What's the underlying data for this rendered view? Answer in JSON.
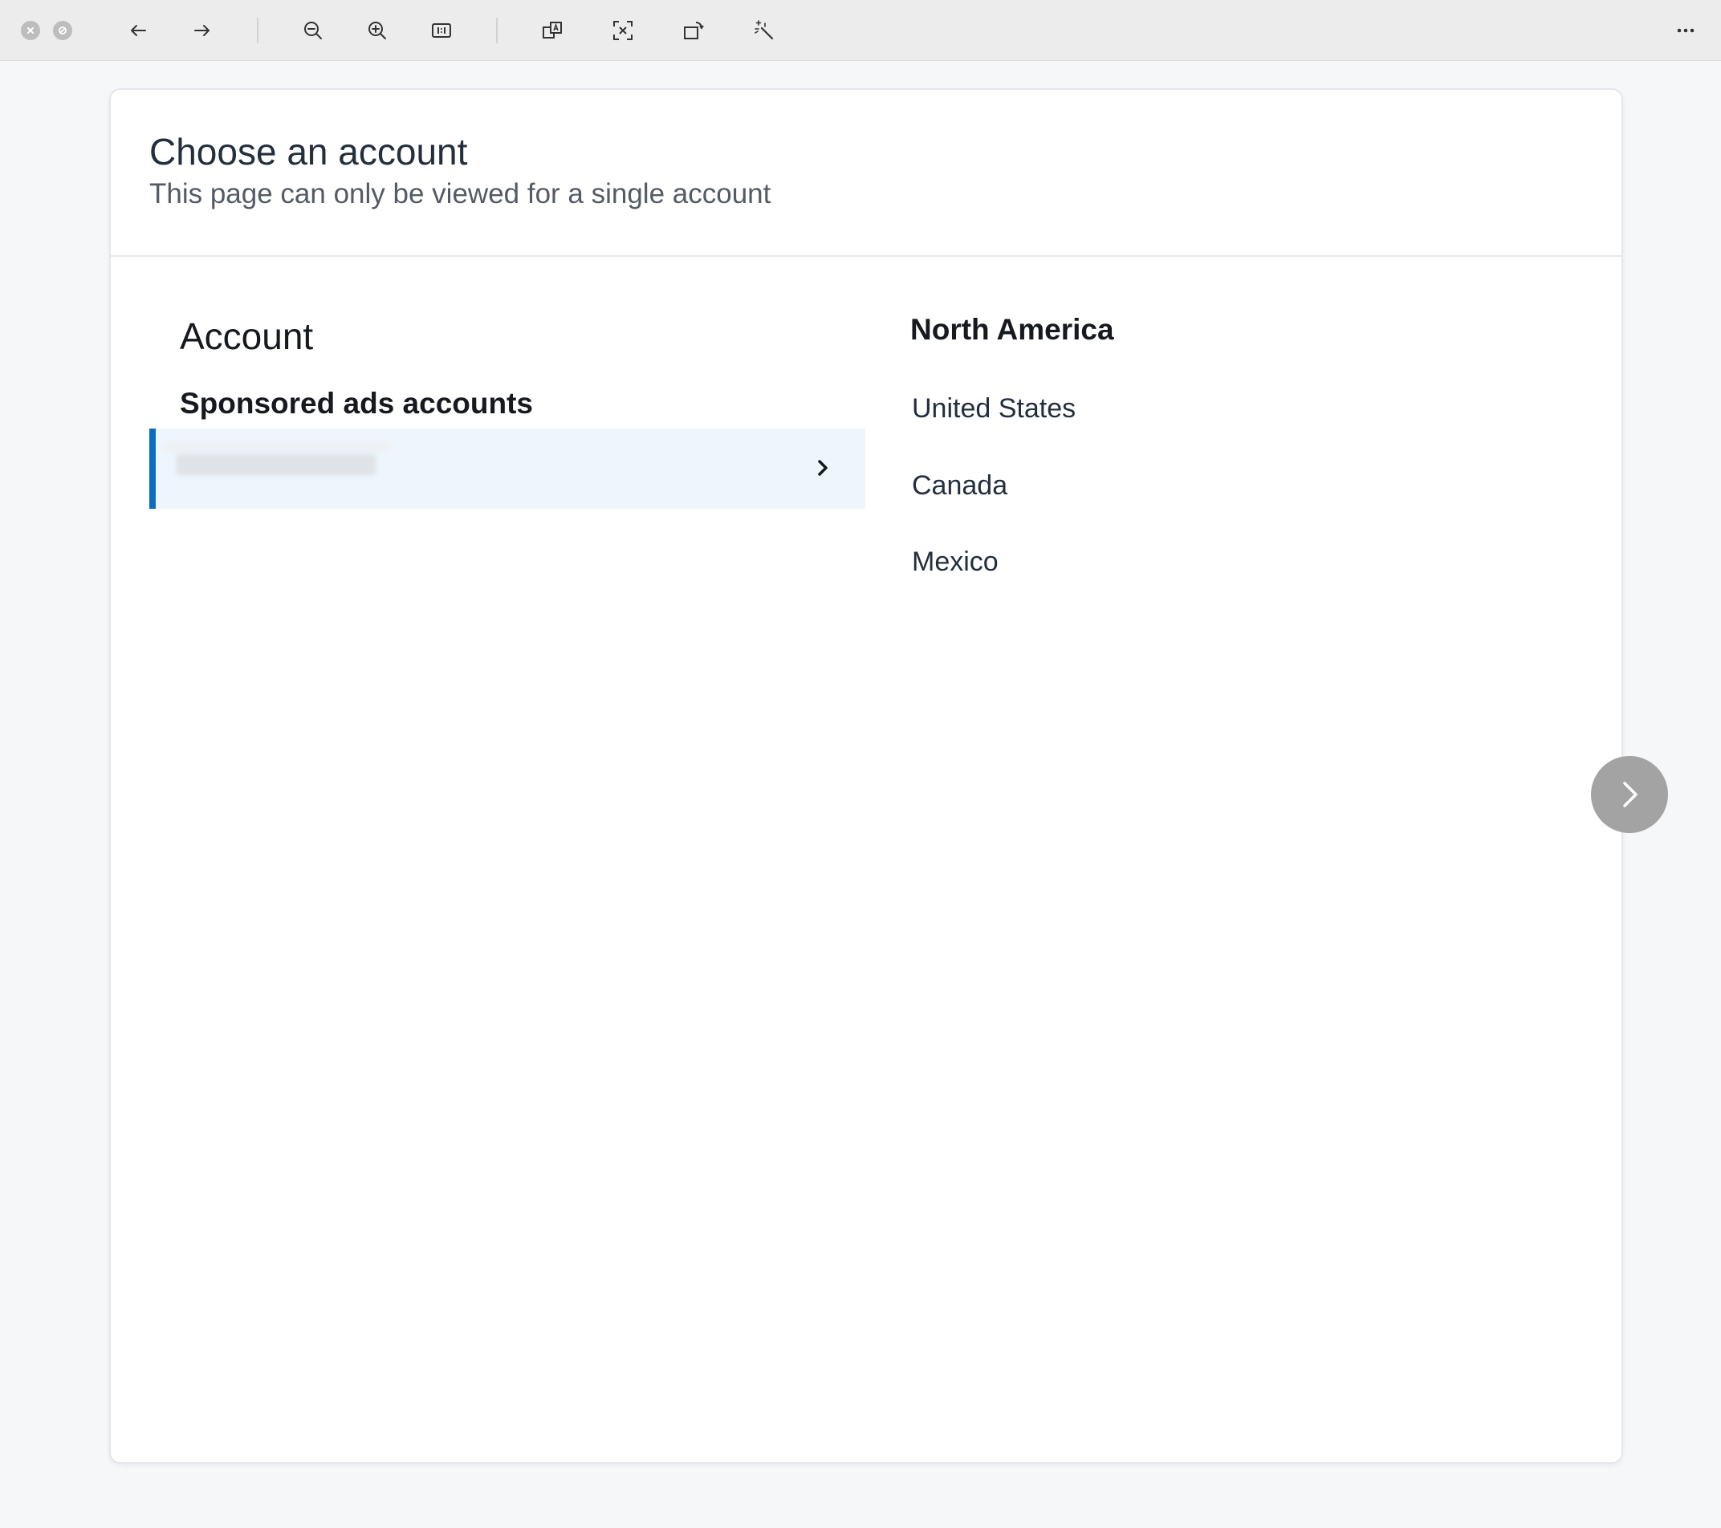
{
  "toolbar": {
    "icons": [
      "close-icon",
      "block-icon",
      "back-arrow-icon",
      "forward-arrow-icon",
      "zoom-out-icon",
      "zoom-in-icon",
      "actual-size-icon",
      "translate-icon",
      "text-extract-icon",
      "rotate-icon",
      "magic-wand-icon",
      "more-icon"
    ]
  },
  "header": {
    "title": "Choose an account",
    "subtitle": "This page can only be viewed for a single account"
  },
  "accounts": {
    "section_title": "Account",
    "group_label": "Sponsored ads accounts",
    "selected_account_name": ""
  },
  "region": {
    "title": "North America",
    "countries": [
      "United States",
      "Canada",
      "Mexico"
    ]
  },
  "colors": {
    "accent": "#0b6cc2",
    "selected_row_bg": "#eef5fc",
    "title_text": "#232f3e"
  }
}
